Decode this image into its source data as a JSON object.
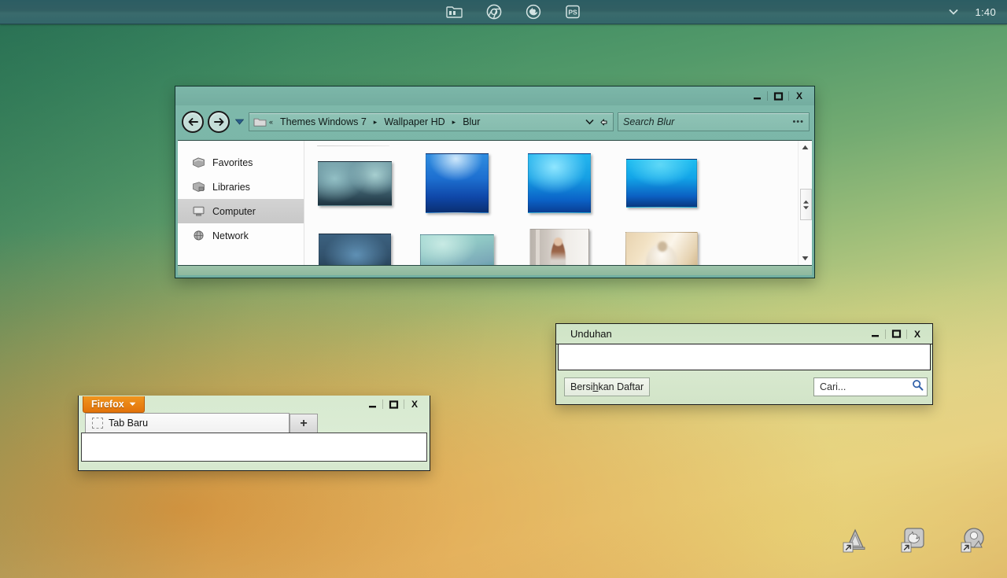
{
  "taskbar": {
    "icons": [
      {
        "name": "file-explorer-icon",
        "label": "File Explorer"
      },
      {
        "name": "chrome-icon",
        "label": "Google Chrome"
      },
      {
        "name": "firefox-icon",
        "label": "Mozilla Firefox"
      },
      {
        "name": "photoshop-icon",
        "label": "PS"
      }
    ],
    "tray_chevron": "▼",
    "clock": "1:40"
  },
  "explorer": {
    "window_controls": {
      "minimize": "—",
      "maximize": "□",
      "close": "X"
    },
    "nav": {
      "back": "←",
      "forward": "→",
      "recent_caret": "▼"
    },
    "address": {
      "overflow": "«",
      "crumbs": [
        "Themes Windows 7",
        "Wallpaper HD",
        "Blur"
      ],
      "separator": "▸",
      "caret": "▽",
      "refresh": "↻"
    },
    "search": {
      "placeholder": "Search Blur",
      "dots": "•••"
    },
    "sidebar": {
      "items": [
        {
          "label": "Favorites",
          "icon": "favorites-icon",
          "selected": false
        },
        {
          "label": "Libraries",
          "icon": "libraries-icon",
          "selected": false
        },
        {
          "label": "Computer",
          "icon": "computer-icon",
          "selected": true
        },
        {
          "label": "Network",
          "icon": "network-icon",
          "selected": false
        }
      ]
    },
    "thumbnails": [
      {
        "name": "blur-teal-dark",
        "type": "gradient",
        "selected": false
      },
      {
        "name": "blur-blue-bright",
        "type": "gradient",
        "selected": false
      },
      {
        "name": "blur-cyan-bright",
        "type": "gradient",
        "selected": false
      },
      {
        "name": "blur-cyan-deep",
        "type": "gradient",
        "selected": false
      },
      {
        "name": "blur-steel-blue",
        "type": "gradient",
        "selected": false
      },
      {
        "name": "blur-mint-teal",
        "type": "gradient",
        "selected": false
      },
      {
        "name": "photo-woman-wall",
        "type": "photo",
        "selected": false
      },
      {
        "name": "photo-bed-morning",
        "type": "photo",
        "selected": false
      },
      {
        "name": "photo-bokeh-gold",
        "type": "photo",
        "selected": false
      },
      {
        "name": "blur-green-orange",
        "type": "gradient",
        "selected": true
      }
    ],
    "scrollbar": {
      "up": "▲",
      "down": "▼",
      "grip": "↕"
    }
  },
  "downloads": {
    "title": "Unduhan",
    "window_controls": {
      "minimize": "—",
      "maximize": "□",
      "close": "X"
    },
    "clear_button": {
      "prefix": "Bersi",
      "accel": "h",
      "suffix": "kan Daftar"
    },
    "search_placeholder": "Cari...",
    "search_icon": "search-icon"
  },
  "firefox": {
    "menu_label": "Firefox",
    "menu_caret": "▼",
    "window_controls": {
      "minimize": "—",
      "maximize": "□",
      "close": "X"
    },
    "tab_label": "Tab Baru",
    "new_tab_label": "+"
  },
  "desktop_icons": [
    {
      "name": "shortcut-autocad",
      "glyph": "A"
    },
    {
      "name": "shortcut-firefox",
      "glyph": "F"
    },
    {
      "name": "shortcut-picasa",
      "glyph": "P"
    }
  ],
  "colors": {
    "taskbar": "#2c5d63",
    "explorer_frame": "#7fb9ab",
    "firefox_orange": "#e2730b",
    "downloads_frame": "#d4e6cb",
    "selection": "#dedede"
  }
}
